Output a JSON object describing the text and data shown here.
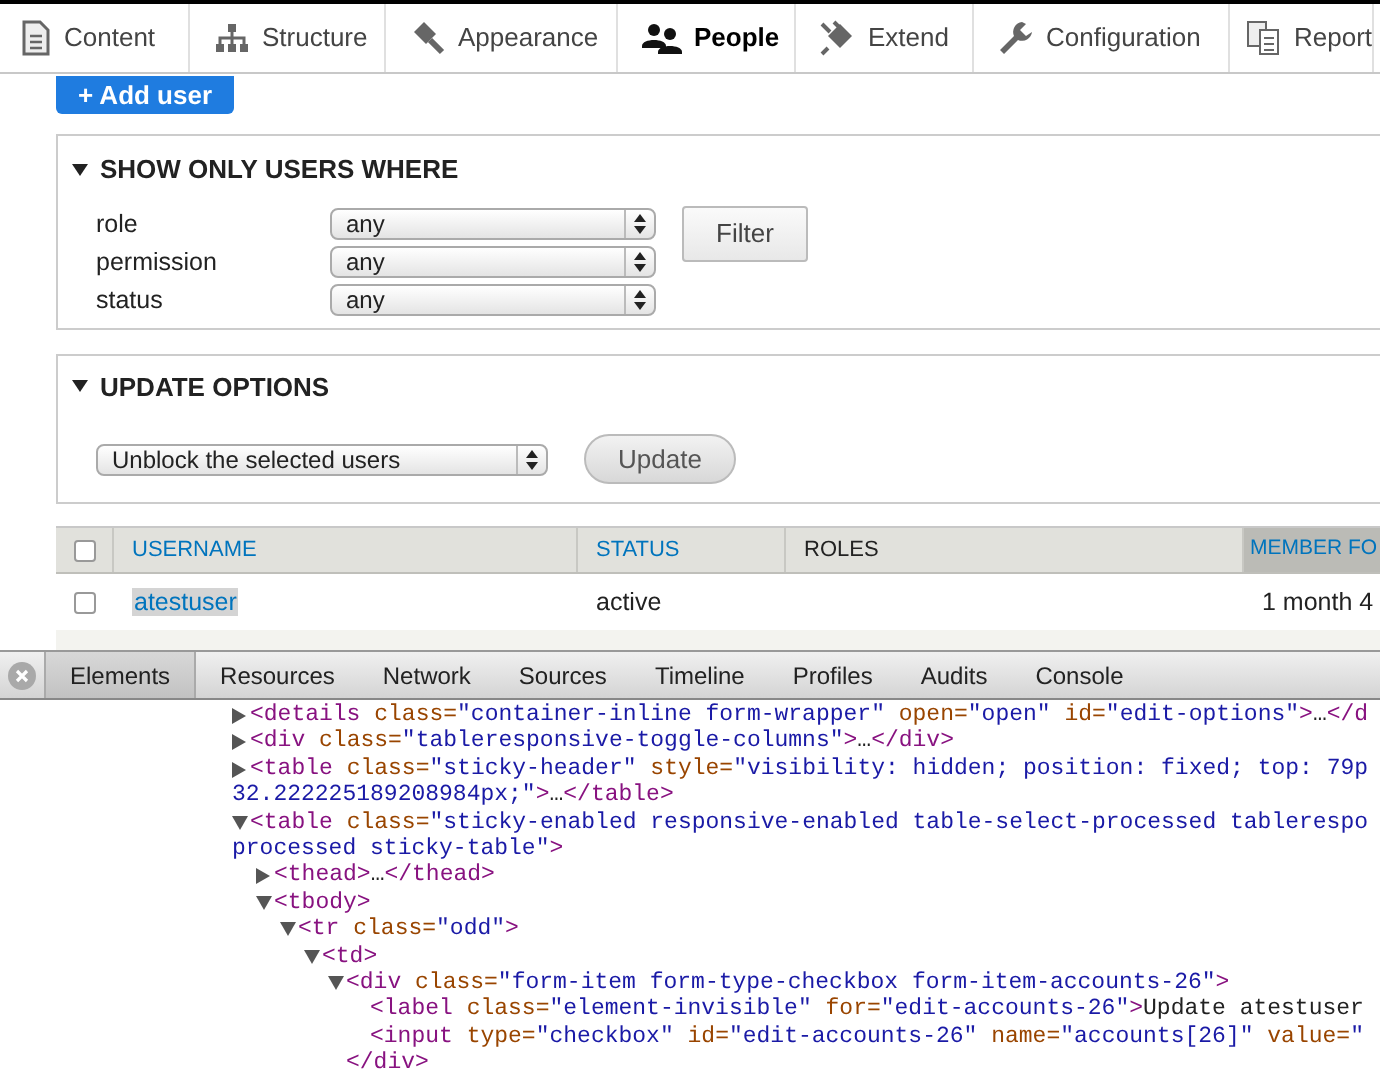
{
  "admin_toolbar": {
    "tabs": [
      {
        "label": "Content",
        "selected": false
      },
      {
        "label": "Structure",
        "selected": false
      },
      {
        "label": "Appearance",
        "selected": false
      },
      {
        "label": "People",
        "selected": true
      },
      {
        "label": "Extend",
        "selected": false
      },
      {
        "label": "Configuration",
        "selected": false
      },
      {
        "label": "Report",
        "selected": false
      }
    ]
  },
  "add_user_button": "+ Add user",
  "filter_panel": {
    "title": "SHOW ONLY USERS WHERE",
    "expanded": true,
    "fields": [
      {
        "label": "role",
        "value": "any"
      },
      {
        "label": "permission",
        "value": "any"
      },
      {
        "label": "status",
        "value": "any"
      }
    ],
    "button": "Filter"
  },
  "update_panel": {
    "title": "UPDATE OPTIONS",
    "expanded": true,
    "select": "Unblock the selected users",
    "button": "Update"
  },
  "users_table": {
    "select_all_checked": false,
    "columns": [
      {
        "label": "USERNAME",
        "kind": "link",
        "selected": false
      },
      {
        "label": "STATUS",
        "kind": "link",
        "selected": false
      },
      {
        "label": "ROLES",
        "kind": "plain",
        "selected": false
      },
      {
        "label": "MEMBER FO",
        "kind": "link",
        "selected": true
      }
    ],
    "rows": [
      {
        "checked": false,
        "username": "atestuser",
        "username_highlighted": true,
        "status": "active",
        "member_for": "1 month 4"
      }
    ]
  },
  "devtools": {
    "tabs": [
      {
        "label": "Elements",
        "selected": true
      },
      {
        "label": "Resources",
        "selected": false
      },
      {
        "label": "Network",
        "selected": false
      },
      {
        "label": "Sources",
        "selected": false
      },
      {
        "label": "Timeline",
        "selected": false
      },
      {
        "label": "Profiles",
        "selected": false
      },
      {
        "label": "Audits",
        "selected": false
      },
      {
        "label": "Console",
        "selected": false
      }
    ],
    "dom_tree": [
      {
        "expanded": false,
        "tokens": [
          {
            "kind": "tag",
            "text": "<details"
          },
          {
            "kind": "attr",
            "text": " class="
          },
          {
            "kind": "value",
            "text": "\"container-inline form-wrapper\""
          },
          {
            "kind": "attr",
            "text": " open="
          },
          {
            "kind": "value",
            "text": "\"open\""
          },
          {
            "kind": "attr",
            "text": " id="
          },
          {
            "kind": "value",
            "text": "\"edit-options\""
          },
          {
            "kind": "tag",
            "text": ">"
          },
          {
            "kind": "text",
            "text": "…"
          },
          {
            "kind": "tag",
            "text": "</d"
          }
        ]
      },
      {
        "expanded": false,
        "tokens": [
          {
            "kind": "tag",
            "text": "<div"
          },
          {
            "kind": "attr",
            "text": " class="
          },
          {
            "kind": "value",
            "text": "\"tableresponsive-toggle-columns\""
          },
          {
            "kind": "tag",
            "text": ">"
          },
          {
            "kind": "text",
            "text": "…"
          },
          {
            "kind": "tag",
            "text": "</div>"
          }
        ]
      },
      {
        "expanded": false,
        "tokens": [
          {
            "kind": "tag",
            "text": "<table"
          },
          {
            "kind": "attr",
            "text": " class="
          },
          {
            "kind": "value",
            "text": "\"sticky-header\""
          },
          {
            "kind": "attr",
            "text": " style="
          },
          {
            "kind": "value",
            "text": "\"visibility: hidden; position: fixed; top: 79p"
          }
        ],
        "continuation": [
          {
            "kind": "value",
            "text": "32.222225189208984px;\""
          },
          {
            "kind": "tag",
            "text": ">"
          },
          {
            "kind": "text",
            "text": "…"
          },
          {
            "kind": "tag",
            "text": "</table>"
          }
        ]
      },
      {
        "expanded": true,
        "tokens": [
          {
            "kind": "tag",
            "text": "<table"
          },
          {
            "kind": "attr",
            "text": " class="
          },
          {
            "kind": "value",
            "text": "\"sticky-enabled responsive-enabled table-select-processed tablerespo"
          }
        ],
        "continuation": [
          {
            "kind": "value",
            "text": "processed sticky-table\""
          },
          {
            "kind": "tag",
            "text": ">"
          }
        ],
        "children": [
          {
            "expanded": false,
            "tokens": [
              {
                "kind": "tag",
                "text": "<thead>"
              },
              {
                "kind": "text",
                "text": "…"
              },
              {
                "kind": "tag",
                "text": "</thead>"
              }
            ]
          },
          {
            "expanded": true,
            "tokens": [
              {
                "kind": "tag",
                "text": "<tbody>"
              }
            ],
            "children": [
              {
                "expanded": true,
                "tokens": [
                  {
                    "kind": "tag",
                    "text": "<tr"
                  },
                  {
                    "kind": "attr",
                    "text": " class="
                  },
                  {
                    "kind": "value",
                    "text": "\"odd\""
                  },
                  {
                    "kind": "tag",
                    "text": ">"
                  }
                ],
                "children": [
                  {
                    "expanded": true,
                    "tokens": [
                      {
                        "kind": "tag",
                        "text": "<td>"
                      }
                    ],
                    "children": [
                      {
                        "expanded": true,
                        "tokens": [
                          {
                            "kind": "tag",
                            "text": "<div"
                          },
                          {
                            "kind": "attr",
                            "text": " class="
                          },
                          {
                            "kind": "value",
                            "text": "\"form-item form-type-checkbox form-item-accounts-26\""
                          },
                          {
                            "kind": "tag",
                            "text": ">"
                          }
                        ],
                        "closing": [
                          {
                            "kind": "tag",
                            "text": "</div>"
                          }
                        ],
                        "children": [
                          {
                            "tokens": [
                              {
                                "kind": "tag",
                                "text": "<label"
                              },
                              {
                                "kind": "attr",
                                "text": " class="
                              },
                              {
                                "kind": "value",
                                "text": "\"element-invisible\""
                              },
                              {
                                "kind": "attr",
                                "text": " for="
                              },
                              {
                                "kind": "value",
                                "text": "\"edit-accounts-26\""
                              },
                              {
                                "kind": "tag",
                                "text": ">"
                              },
                              {
                                "kind": "text",
                                "text": "Update atestuser"
                              }
                            ]
                          },
                          {
                            "tokens": [
                              {
                                "kind": "tag",
                                "text": "<input"
                              },
                              {
                                "kind": "attr",
                                "text": " type="
                              },
                              {
                                "kind": "value",
                                "text": "\"checkbox\""
                              },
                              {
                                "kind": "attr",
                                "text": " id="
                              },
                              {
                                "kind": "value",
                                "text": "\"edit-accounts-26\""
                              },
                              {
                                "kind": "attr",
                                "text": " name="
                              },
                              {
                                "kind": "value",
                                "text": "\"accounts[26]\""
                              },
                              {
                                "kind": "attr",
                                "text": " value="
                              },
                              {
                                "kind": "value",
                                "text": "\""
                              }
                            ]
                          }
                        ]
                      }
                    ]
                  }
                ]
              }
            ]
          }
        ]
      }
    ]
  }
}
